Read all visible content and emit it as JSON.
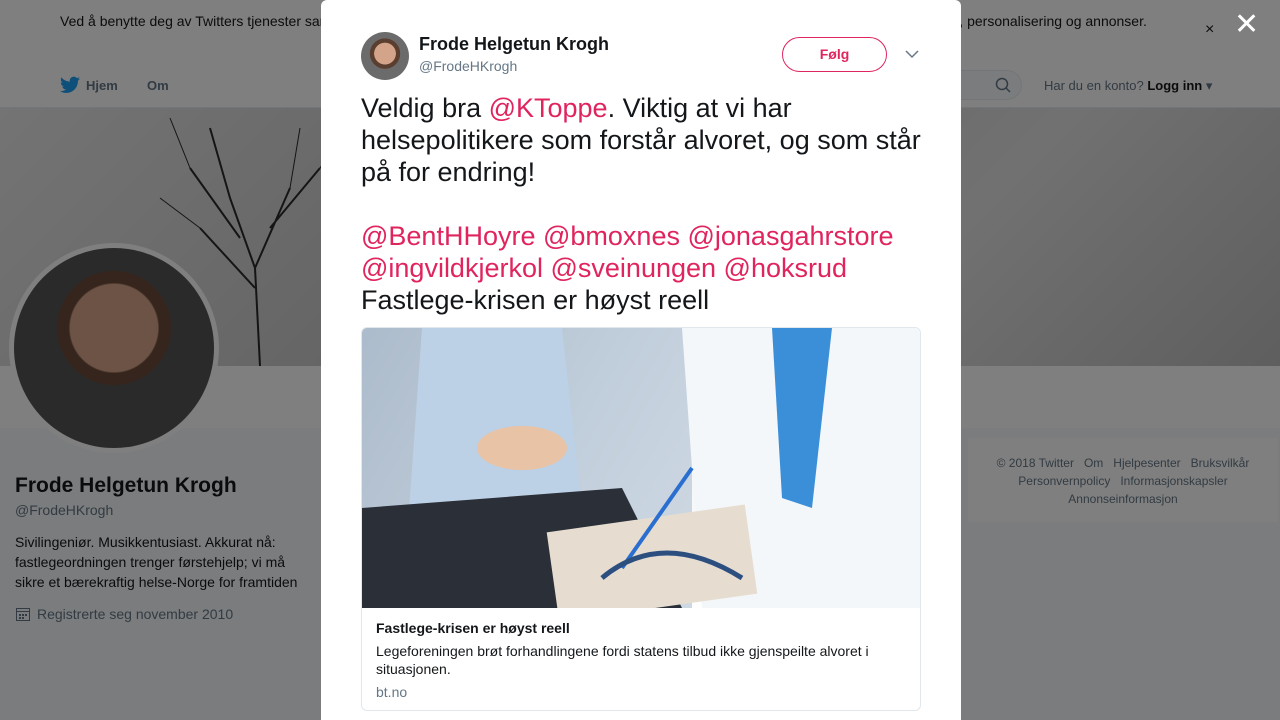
{
  "cookie": {
    "text": "Ved å benytte deg av Twitters tjenester samtykker du i vår bruk av informasjonskapsler og deling av data om informasjonskapsler til bl.a. analyser, personalisering og annonser.",
    "close": "×"
  },
  "nav": {
    "home": "Hjem",
    "about": "Om",
    "account_q": "Har du en konto?",
    "login": "Logg inn"
  },
  "profile": {
    "name": "Frode Helgetun Krogh",
    "handle": "@FrodeHKrogh",
    "bio": "Sivilingeniør. Musikkentusiast. Akkurat nå: fastlegeordningen trenger førstehjelp; vi må sikre et bærekraftig helse-Norge for framtiden",
    "joined": "Registrerte seg november 2010"
  },
  "footer": {
    "items": [
      "© 2018 Twitter",
      "Om",
      "Hjelpesenter",
      "Bruksvilkår",
      "Personvernpolicy",
      "Informasjonskapsler",
      "Annonseinformasjon"
    ]
  },
  "modal": {
    "close": "✕",
    "name": "Frode Helgetun Krogh",
    "handle": "@FrodeHKrogh",
    "follow": "Følg",
    "tweet": {
      "t1": "Veldig bra ",
      "m1": "@KToppe",
      "t2": ". Viktig at vi har helsepolitikere som forstår alvoret, og som står på for endring!",
      "mentions": [
        "@BentHHoyre",
        "@bmoxnes",
        "@jonasgahrstore",
        "@ingvildkjerkol",
        "@sveinungen",
        "@hoksrud"
      ],
      "t3": "Fastlege-krisen er høyst reell"
    },
    "card": {
      "title": "Fastlege-krisen er høyst reell",
      "desc": "Legeforeningen brøt forhandlingene fordi statens tilbud ikke gjenspeilte alvoret i situasjonen.",
      "url": "bt.no"
    }
  },
  "colors": {
    "accent": "#e0245e",
    "twitter_blue": "#1da1f2"
  }
}
